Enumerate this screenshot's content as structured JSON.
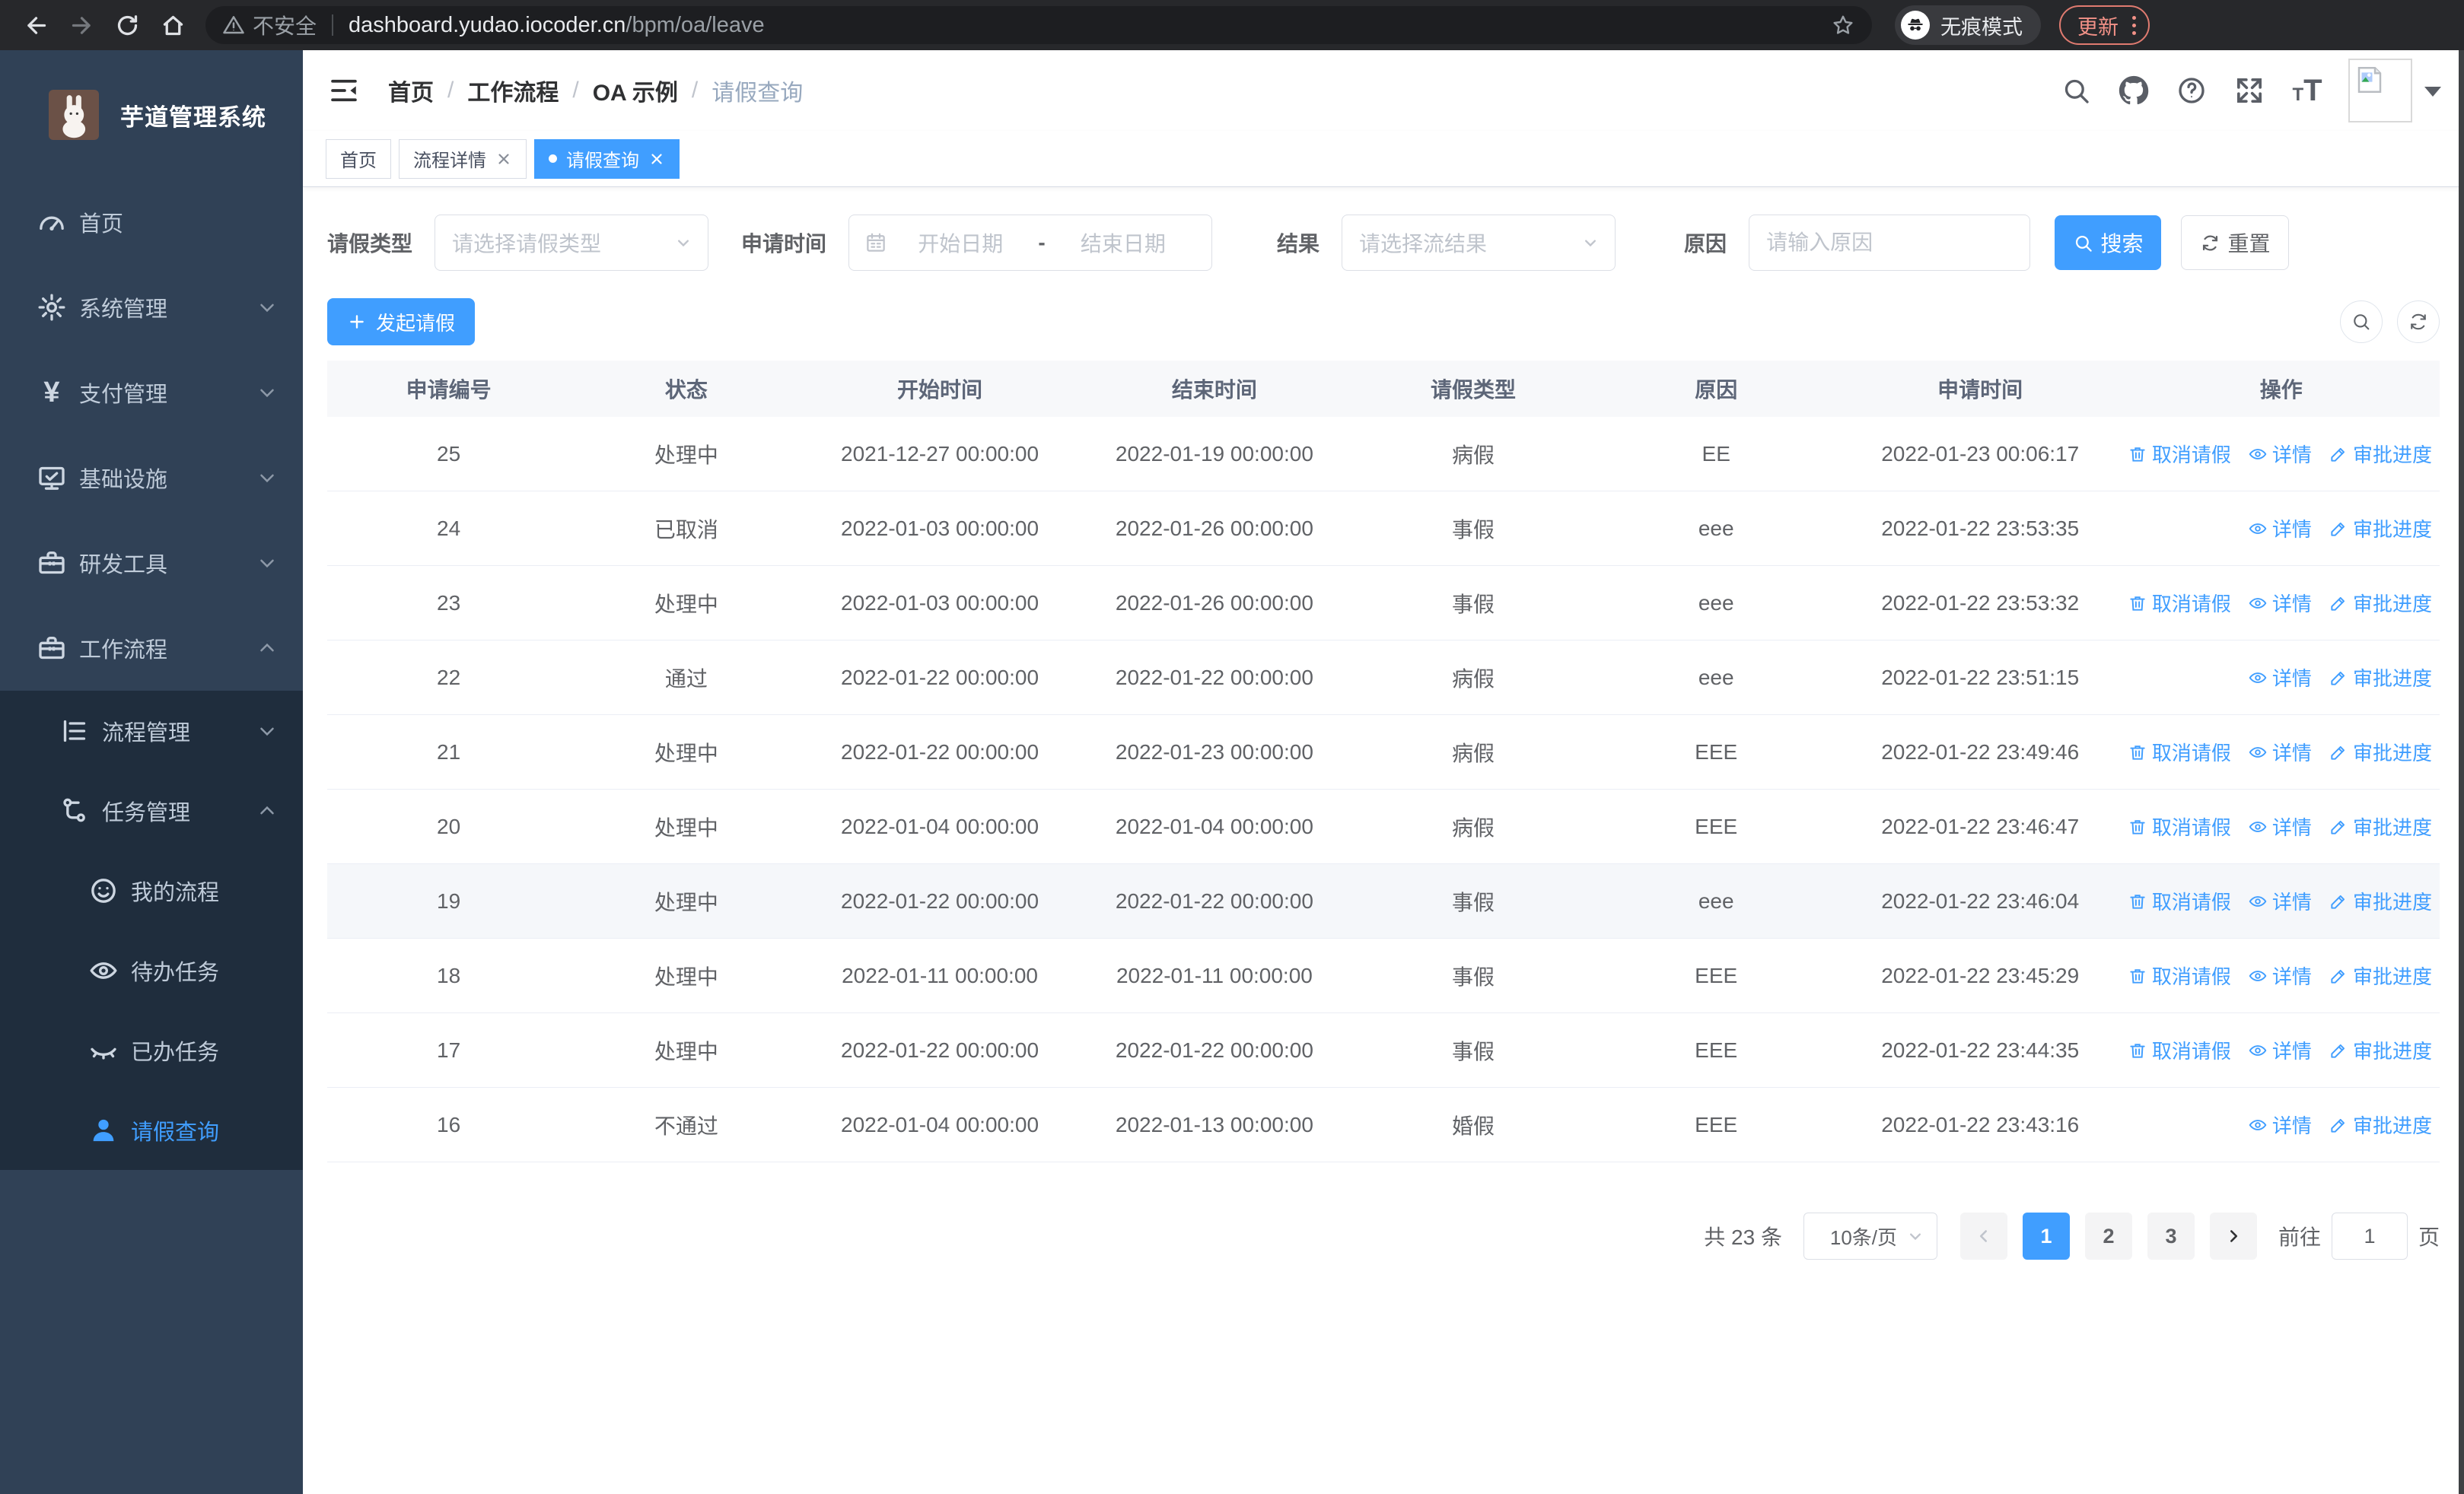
{
  "browser": {
    "security_label": "不安全",
    "url_host": "dashboard.yudao.iocoder.cn",
    "url_path": "/bpm/oa/leave",
    "incognito_label": "无痕模式",
    "update_label": "更新"
  },
  "sidebar": {
    "title": "芋道管理系统",
    "menu": [
      {
        "label": "首页",
        "level": 1
      },
      {
        "label": "系统管理",
        "level": 1,
        "chevron": "down"
      },
      {
        "label": "支付管理",
        "level": 1,
        "chevron": "down"
      },
      {
        "label": "基础设施",
        "level": 1,
        "chevron": "down"
      },
      {
        "label": "研发工具",
        "level": 1,
        "chevron": "down"
      },
      {
        "label": "工作流程",
        "level": 1,
        "chevron": "up"
      },
      {
        "label": "流程管理",
        "level": 2,
        "chevron": "down"
      },
      {
        "label": "任务管理",
        "level": 2,
        "chevron": "up"
      },
      {
        "label": "我的流程",
        "level": 3
      },
      {
        "label": "待办任务",
        "level": 3
      },
      {
        "label": "已办任务",
        "level": 3
      },
      {
        "label": "请假查询",
        "level": 3,
        "active": true
      }
    ]
  },
  "header": {
    "breadcrumb": [
      "首页",
      "工作流程",
      "OA 示例",
      "请假查询"
    ]
  },
  "tabs": [
    {
      "label": "首页",
      "closable": false,
      "active": false
    },
    {
      "label": "流程详情",
      "closable": true,
      "active": false
    },
    {
      "label": "请假查询",
      "closable": true,
      "active": true
    }
  ],
  "filters": {
    "leave_type_label": "请假类型",
    "leave_type_placeholder": "请选择请假类型",
    "apply_time_label": "申请时间",
    "date_start_placeholder": "开始日期",
    "date_separator": "-",
    "date_end_placeholder": "结束日期",
    "result_label": "结果",
    "result_placeholder": "请选择流结果",
    "reason_label": "原因",
    "reason_placeholder": "请输入原因",
    "search_label": "搜索",
    "reset_label": "重置"
  },
  "toolbar": {
    "create_label": "发起请假"
  },
  "table": {
    "columns": [
      "申请编号",
      "状态",
      "开始时间",
      "结束时间",
      "请假类型",
      "原因",
      "申请时间",
      "操作"
    ],
    "action_labels": {
      "cancel": "取消请假",
      "detail": "详情",
      "progress": "审批进度"
    },
    "rows": [
      {
        "id": "25",
        "status": "处理中",
        "start": "2021-12-27 00:00:00",
        "end": "2022-01-19 00:00:00",
        "type": "病假",
        "reason": "EE",
        "apply": "2022-01-23 00:06:17",
        "actions": [
          "cancel",
          "detail",
          "progress"
        ],
        "highlight": false
      },
      {
        "id": "24",
        "status": "已取消",
        "start": "2022-01-03 00:00:00",
        "end": "2022-01-26 00:00:00",
        "type": "事假",
        "reason": "eee",
        "apply": "2022-01-22 23:53:35",
        "actions": [
          "detail",
          "progress"
        ],
        "highlight": false
      },
      {
        "id": "23",
        "status": "处理中",
        "start": "2022-01-03 00:00:00",
        "end": "2022-01-26 00:00:00",
        "type": "事假",
        "reason": "eee",
        "apply": "2022-01-22 23:53:32",
        "actions": [
          "cancel",
          "detail",
          "progress"
        ],
        "highlight": false
      },
      {
        "id": "22",
        "status": "通过",
        "start": "2022-01-22 00:00:00",
        "end": "2022-01-22 00:00:00",
        "type": "病假",
        "reason": "eee",
        "apply": "2022-01-22 23:51:15",
        "actions": [
          "detail",
          "progress"
        ],
        "highlight": false
      },
      {
        "id": "21",
        "status": "处理中",
        "start": "2022-01-22 00:00:00",
        "end": "2022-01-23 00:00:00",
        "type": "病假",
        "reason": "EEE",
        "apply": "2022-01-22 23:49:46",
        "actions": [
          "cancel",
          "detail",
          "progress"
        ],
        "highlight": false
      },
      {
        "id": "20",
        "status": "处理中",
        "start": "2022-01-04 00:00:00",
        "end": "2022-01-04 00:00:00",
        "type": "病假",
        "reason": "EEE",
        "apply": "2022-01-22 23:46:47",
        "actions": [
          "cancel",
          "detail",
          "progress"
        ],
        "highlight": false
      },
      {
        "id": "19",
        "status": "处理中",
        "start": "2022-01-22 00:00:00",
        "end": "2022-01-22 00:00:00",
        "type": "事假",
        "reason": "eee",
        "apply": "2022-01-22 23:46:04",
        "actions": [
          "cancel",
          "detail",
          "progress"
        ],
        "highlight": true
      },
      {
        "id": "18",
        "status": "处理中",
        "start": "2022-01-11 00:00:00",
        "end": "2022-01-11 00:00:00",
        "type": "事假",
        "reason": "EEE",
        "apply": "2022-01-22 23:45:29",
        "actions": [
          "cancel",
          "detail",
          "progress"
        ],
        "highlight": false
      },
      {
        "id": "17",
        "status": "处理中",
        "start": "2022-01-22 00:00:00",
        "end": "2022-01-22 00:00:00",
        "type": "事假",
        "reason": "EEE",
        "apply": "2022-01-22 23:44:35",
        "actions": [
          "cancel",
          "detail",
          "progress"
        ],
        "highlight": false
      },
      {
        "id": "16",
        "status": "不通过",
        "start": "2022-01-04 00:00:00",
        "end": "2022-01-13 00:00:00",
        "type": "婚假",
        "reason": "EEE",
        "apply": "2022-01-22 23:43:16",
        "actions": [
          "detail",
          "progress"
        ],
        "highlight": false
      }
    ]
  },
  "pagination": {
    "total_text": "共 23 条",
    "page_size": "10条/页",
    "pages": [
      "1",
      "2",
      "3"
    ],
    "active_page": "1",
    "goto_label": "前往",
    "goto_value": "1",
    "goto_suffix": "页"
  },
  "colors": {
    "accent": "#409eff",
    "sidebar_bg": "#304156",
    "submenu_bg": "#1f2d3d",
    "update_accent": "#f29187",
    "table_border": "#ebeef5",
    "hover_row": "#f5f7fa"
  }
}
